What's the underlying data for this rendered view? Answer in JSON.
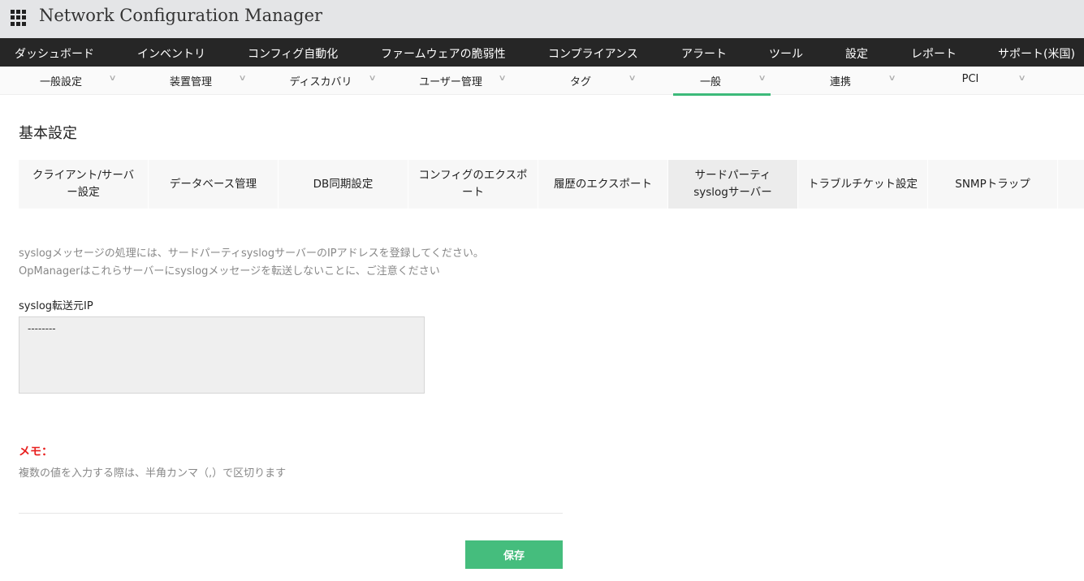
{
  "app": {
    "title": "Network Configuration Manager"
  },
  "topnav": [
    "ダッシュボード",
    "インベントリ",
    "コンフィグ自動化",
    "ファームウェアの脆弱性",
    "コンプライアンス",
    "アラート",
    "ツール",
    "設定",
    "レポート",
    "サポート(米国)"
  ],
  "subnav": [
    "一般設定",
    "装置管理",
    "ディスカバリ",
    "ユーザー管理",
    "タグ",
    "一般",
    "連携",
    "PCI"
  ],
  "subnav_active": "一般",
  "page_title": "基本設定",
  "tabs": [
    "クライアント/サーバー設定",
    "データベース管理",
    "DB同期設定",
    "コンフィグのエクスポート",
    "履歴のエクスポート",
    "サードパーティsyslogサーバー",
    "トラブルチケット設定",
    "SNMPトラップ"
  ],
  "active_tab": "サードパーティsyslogサーバー",
  "description": [
    "syslogメッセージの処理には、サードパーティsyslogサーバーのIPアドレスを登録してください。",
    "OpManagerはこれらサーバーにsyslogメッセージを転送しないことに、ご注意ください"
  ],
  "field": {
    "label": "syslog転送元IP",
    "value": "--------"
  },
  "memo": {
    "title": "メモ：",
    "text": "複数の値を入力する際は、半角カンマ（,）で区切ります"
  },
  "save_label": "保存",
  "colors": {
    "accent": "#45bd7d",
    "nav_bg": "#262626",
    "memo": "#e8201f"
  }
}
